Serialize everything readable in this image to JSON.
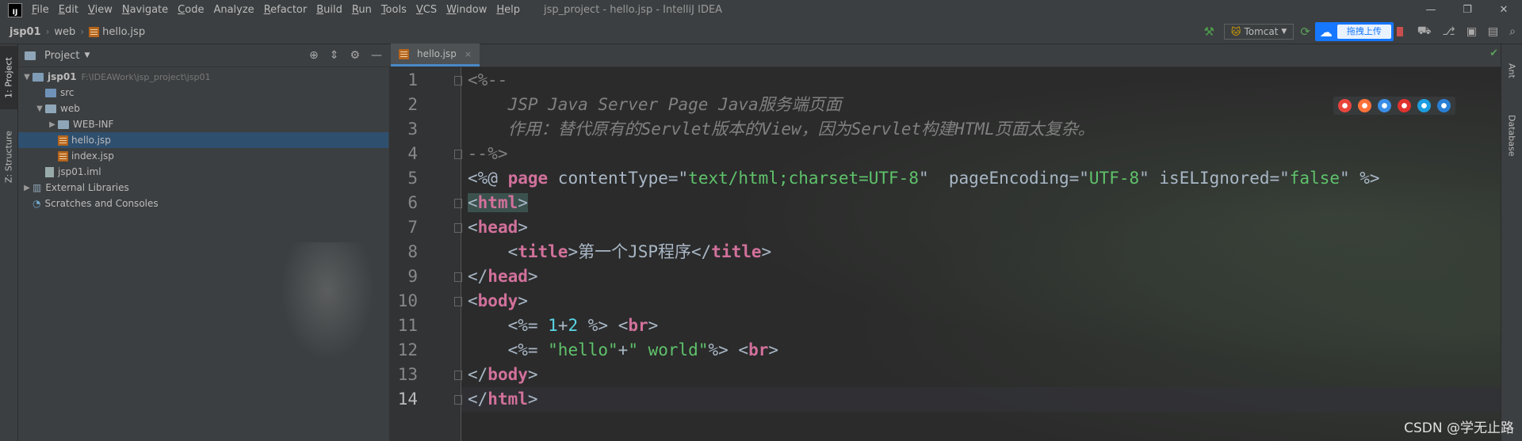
{
  "window": {
    "title": "jsp_project - hello.jsp - IntelliJ IDEA",
    "menu": [
      {
        "label": "File",
        "u": "F",
        "rest": "ile"
      },
      {
        "label": "Edit",
        "u": "E",
        "rest": "dit"
      },
      {
        "label": "View",
        "u": "V",
        "rest": "iew"
      },
      {
        "label": "Navigate",
        "u": "N",
        "rest": "avigate"
      },
      {
        "label": "Code",
        "u": "C",
        "rest": "ode"
      },
      {
        "label": "Analyze",
        "u": "",
        "rest": "Analyze"
      },
      {
        "label": "Refactor",
        "u": "R",
        "rest": "efactor"
      },
      {
        "label": "Build",
        "u": "B",
        "rest": "uild"
      },
      {
        "label": "Run",
        "u": "R",
        "rest": "un"
      },
      {
        "label": "Tools",
        "u": "T",
        "rest": "ools"
      },
      {
        "label": "VCS",
        "u": "V",
        "rest": "CS"
      },
      {
        "label": "Window",
        "u": "W",
        "rest": "indow"
      },
      {
        "label": "Help",
        "u": "H",
        "rest": "elp"
      }
    ]
  },
  "breadcrumbs": [
    "jsp01",
    "web",
    "hello.jsp"
  ],
  "toolbar": {
    "run_config": "Tomcat",
    "upload_label": "拖拽上传"
  },
  "side_tabs": {
    "project": "1: Project",
    "structure": "Z: Structure",
    "ant": "Ant",
    "database": "Database"
  },
  "project_panel": {
    "title": "Project",
    "tree": [
      {
        "label": "jsp01",
        "path": "F:\\IDEAWork\\jsp_project\\jsp01",
        "indent": 0,
        "arrow": "▼",
        "icon": "module",
        "bold": true
      },
      {
        "label": "src",
        "indent": 1,
        "arrow": "",
        "icon": "folder-blue"
      },
      {
        "label": "web",
        "indent": 1,
        "arrow": "▼",
        "icon": "folder"
      },
      {
        "label": "WEB-INF",
        "indent": 2,
        "arrow": "▶",
        "icon": "folder"
      },
      {
        "label": "hello.jsp",
        "indent": 2,
        "arrow": "",
        "icon": "jsp",
        "selected": true
      },
      {
        "label": "index.jsp",
        "indent": 2,
        "arrow": "",
        "icon": "jsp"
      },
      {
        "label": "jsp01.iml",
        "indent": 1,
        "arrow": "",
        "icon": "iml"
      },
      {
        "label": "External Libraries",
        "indent": 0,
        "arrow": "▶",
        "icon": "lib"
      },
      {
        "label": "Scratches and Consoles",
        "indent": 0,
        "arrow": "",
        "icon": "scratch"
      }
    ]
  },
  "editor": {
    "tab_label": "hello.jsp",
    "line_numbers": [
      "1",
      "2",
      "3",
      "4",
      "5",
      "6",
      "7",
      "8",
      "9",
      "10",
      "11",
      "12",
      "13",
      "14"
    ],
    "current_line": 14,
    "lines": [
      [
        {
          "t": "<%--",
          "c": "c-comment"
        }
      ],
      [
        {
          "t": "    JSP Java Server Page Java服务端页面",
          "c": "c-comment"
        }
      ],
      [
        {
          "t": "    作用：替代原有的Servlet版本的View，因为Servlet构建HTML页面太复杂。",
          "c": "c-comment"
        }
      ],
      [
        {
          "t": "--%>",
          "c": "c-comment"
        }
      ],
      [
        {
          "t": "<%@ ",
          "c": ""
        },
        {
          "t": "page",
          "c": "c-pink"
        },
        {
          "t": " contentType=\"",
          "c": ""
        },
        {
          "t": "text/html;charset=UTF-8",
          "c": "c-green"
        },
        {
          "t": "\"  pageEncoding=\"",
          "c": ""
        },
        {
          "t": "UTF-8",
          "c": "c-green"
        },
        {
          "t": "\" isELIgnored=\"",
          "c": ""
        },
        {
          "t": "false",
          "c": "c-green"
        },
        {
          "t": "\" %>",
          "c": ""
        }
      ],
      [
        {
          "t": "<",
          "c": "c-hl"
        },
        {
          "t": "html",
          "c": "c-pink c-hl"
        },
        {
          "t": ">",
          "c": "c-hl"
        }
      ],
      [
        {
          "t": "<",
          "c": ""
        },
        {
          "t": "head",
          "c": "c-pink"
        },
        {
          "t": ">",
          "c": ""
        }
      ],
      [
        {
          "t": "    <",
          "c": ""
        },
        {
          "t": "title",
          "c": "c-pink"
        },
        {
          "t": ">第一个JSP程序</",
          "c": ""
        },
        {
          "t": "title",
          "c": "c-pink"
        },
        {
          "t": ">",
          "c": ""
        }
      ],
      [
        {
          "t": "</",
          "c": ""
        },
        {
          "t": "head",
          "c": "c-pink"
        },
        {
          "t": ">",
          "c": ""
        }
      ],
      [
        {
          "t": "<",
          "c": ""
        },
        {
          "t": "body",
          "c": "c-pink"
        },
        {
          "t": ">",
          "c": ""
        }
      ],
      [
        {
          "t": "    <%= ",
          "c": ""
        },
        {
          "t": "1",
          "c": "c-cyan"
        },
        {
          "t": "+",
          "c": ""
        },
        {
          "t": "2",
          "c": "c-cyan"
        },
        {
          "t": " %> <",
          "c": ""
        },
        {
          "t": "br",
          "c": "c-pink"
        },
        {
          "t": ">",
          "c": ""
        }
      ],
      [
        {
          "t": "    <%= ",
          "c": ""
        },
        {
          "t": "\"hello\"",
          "c": "c-green"
        },
        {
          "t": "+",
          "c": ""
        },
        {
          "t": "\" world\"",
          "c": "c-green"
        },
        {
          "t": "%> <",
          "c": ""
        },
        {
          "t": "br",
          "c": "c-pink"
        },
        {
          "t": ">",
          "c": ""
        }
      ],
      [
        {
          "t": "</",
          "c": ""
        },
        {
          "t": "body",
          "c": "c-pink"
        },
        {
          "t": ">",
          "c": ""
        }
      ],
      [
        {
          "t": "</",
          "c": ""
        },
        {
          "t": "html",
          "c": "c-pink"
        },
        {
          "t": ">",
          "c": ""
        }
      ]
    ]
  },
  "browsers": [
    {
      "name": "chrome-icon",
      "color": "#e8453c"
    },
    {
      "name": "firefox-icon",
      "color": "#ff7139"
    },
    {
      "name": "safari-icon",
      "color": "#3a8ee6"
    },
    {
      "name": "opera-icon",
      "color": "#e0322e"
    },
    {
      "name": "ie-icon",
      "color": "#1d9de0"
    },
    {
      "name": "edge-icon",
      "color": "#2a7fd4"
    }
  ],
  "watermark": "CSDN @学无止路"
}
